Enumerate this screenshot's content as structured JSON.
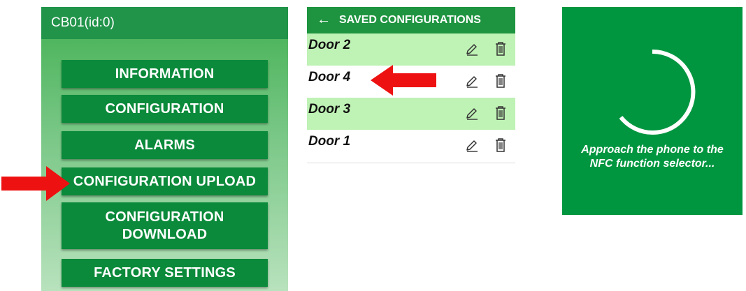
{
  "menu_panel": {
    "header_title": "CB01(id:0)",
    "buttons": [
      {
        "label": "INFORMATION"
      },
      {
        "label": "CONFIGURATION"
      },
      {
        "label": "ALARMS"
      },
      {
        "label": "CONFIGURATION UPLOAD"
      },
      {
        "label_line1": "CONFIGURATION",
        "label_line2": "DOWNLOAD"
      },
      {
        "label": "FACTORY SETTINGS"
      }
    ],
    "colors": {
      "header": "#21944a",
      "button": "#0a8a3a",
      "arrow": "#ee1111"
    }
  },
  "saved_panel": {
    "back_icon": "arrow-left-icon",
    "title": "SAVED CONFIGURATIONS",
    "rows": [
      {
        "name": "Door 2",
        "highlighted": true
      },
      {
        "name": "Door 4",
        "highlighted": false
      },
      {
        "name": "Door 3",
        "highlighted": true
      },
      {
        "name": "Door 1",
        "highlighted": false
      }
    ],
    "row_icons": [
      "pencil-edit-icon",
      "trash-delete-icon"
    ],
    "colors": {
      "header": "#1f9440",
      "highlight": "#bff2b5"
    }
  },
  "nfc_panel": {
    "spinner_icon": "loading-spinner-icon",
    "message_line1": "Approach the phone to the",
    "message_line2": "NFC function selector...",
    "colors": {
      "background": "#009640"
    }
  }
}
